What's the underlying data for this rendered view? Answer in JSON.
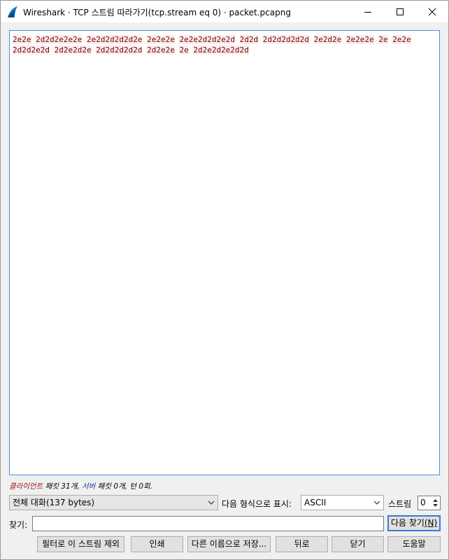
{
  "window": {
    "title": "Wireshark · TCP 스트림 따라가기(tcp.stream eq 0) · packet.pcapng",
    "controls": [
      "minimize",
      "maximize",
      "close"
    ]
  },
  "stream": {
    "segments": [
      "2e2e",
      "2d2d2e2e2e",
      "2e2d2d2d2d2e",
      "2e2e2e",
      "2e2e2d2d2e2d",
      "2d2d",
      "2d2d2d2d2d",
      "2e2d2e",
      "2e2e2e",
      "2e",
      "2e2e",
      "2d2d2e2d",
      "2d2e2d2e",
      "2d2d2d2d2d",
      "2d2e2e",
      "2e",
      "2d2e2d2e2d2d"
    ],
    "text_color": "#7a0000",
    "highlight_color": "#fbeded"
  },
  "stats": {
    "client_label": "클라이언트",
    "client_text": " 패킷 31개, ",
    "server_label": "서버",
    "server_text": " 패킷 0개, 턴 0회."
  },
  "conversation": {
    "selected": "전체 대화(137 bytes)"
  },
  "format": {
    "label": "다음 형식으로 표시:",
    "selected": "ASCII"
  },
  "stream_selector": {
    "label": "스트림",
    "value": "0"
  },
  "find": {
    "label": "찾기:",
    "value": "",
    "find_next_label": "다음 찾기",
    "find_next_accel": "(N)"
  },
  "buttons": {
    "filter_out": "필터로 이 스트림 제외",
    "print": "인쇄",
    "save_as": "다른 이름으로 저장...",
    "back": "뒤로",
    "close": "닫기",
    "help": "도움말"
  },
  "colors": {
    "accent": "#3a7bd5",
    "client": "#a0151a",
    "server": "#1a3aa0"
  }
}
